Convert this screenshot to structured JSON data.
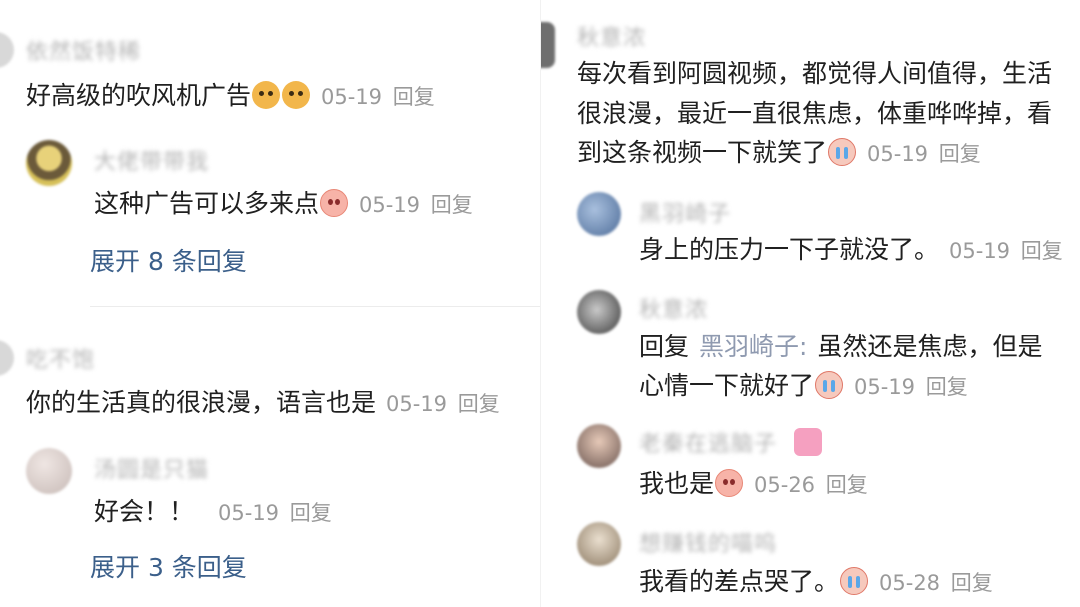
{
  "left": {
    "c1": {
      "name": "依然饭特稀",
      "text": "好高级的吹风机广告",
      "emojis": [
        "doge-icon",
        "doge-icon"
      ],
      "date": "05-19",
      "reply_label": "回复",
      "sub": {
        "name": "大佬带带我",
        "text": "这种广告可以多来点",
        "date": "05-19",
        "reply_label": "回复"
      },
      "expand": "展开 8 条回复"
    },
    "c2": {
      "name": "吃不饱",
      "text": "你的生活真的很浪漫，语言也是",
      "date": "05-19",
      "reply_label": "回复",
      "sub": {
        "name": "汤圆是只猫",
        "text": "好会！！",
        "date": "05-19",
        "reply_label": "回复"
      },
      "expand": "展开 3 条回复"
    }
  },
  "right": {
    "main": {
      "name": "秋意浓",
      "line1": "每次看到阿圆视频，都觉得人间值得，生活",
      "line2": "很浪漫，最近一直很焦虑，体重哗哗掉，看",
      "line3": "到这条视频一下就笑了",
      "date": "05-19",
      "reply_label": "回复"
    },
    "replies": [
      {
        "name": "黑羽崎子",
        "text": "身上的压力一下子就没了。",
        "date": "05-19",
        "reply_label": "回复"
      },
      {
        "name": "秋意浓",
        "prefix": "回复",
        "mention": "黑羽崎子:",
        "line1": "虽然还是焦虑，但是",
        "line2": "心情一下就好了",
        "date": "05-19",
        "reply_label": "回复"
      },
      {
        "name": "老秦在逃脑子",
        "text": "我也是",
        "date": "05-26",
        "reply_label": "回复"
      },
      {
        "name": "想赚钱的喵呜",
        "text": "我看的差点哭了。",
        "date": "05-28",
        "reply_label": "回复"
      }
    ]
  },
  "colors": {
    "link_blue": "#3b5f8a",
    "meta_gray": "#9a9a9a",
    "name_gray": "#b4b4b4",
    "mention": "#8f9ab0"
  }
}
